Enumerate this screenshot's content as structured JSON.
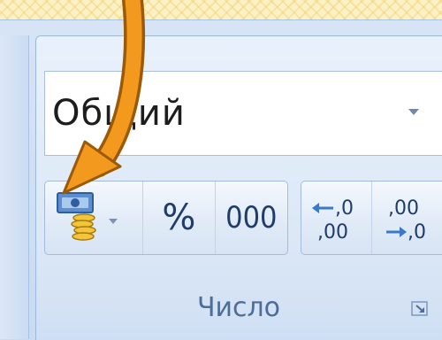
{
  "number_group": {
    "format_dropdown": {
      "value": "Общий"
    },
    "buttons": {
      "currency": {
        "icon": "currency-format-icon"
      },
      "percent": {
        "label": "%"
      },
      "thousands": {
        "label": "000"
      },
      "increase_decimal": {
        "icon": "increase-decimal-icon",
        "top": "←,0",
        "bottom": ",00"
      },
      "decrease_decimal": {
        "icon": "decrease-decimal-icon",
        "top": ",00",
        "bottom": "→,0"
      }
    },
    "label": "Число",
    "launcher_icon": "dialog-launcher-icon"
  },
  "annotation": {
    "icon": "pointer-arrow-icon",
    "color": "#f39a1e"
  }
}
